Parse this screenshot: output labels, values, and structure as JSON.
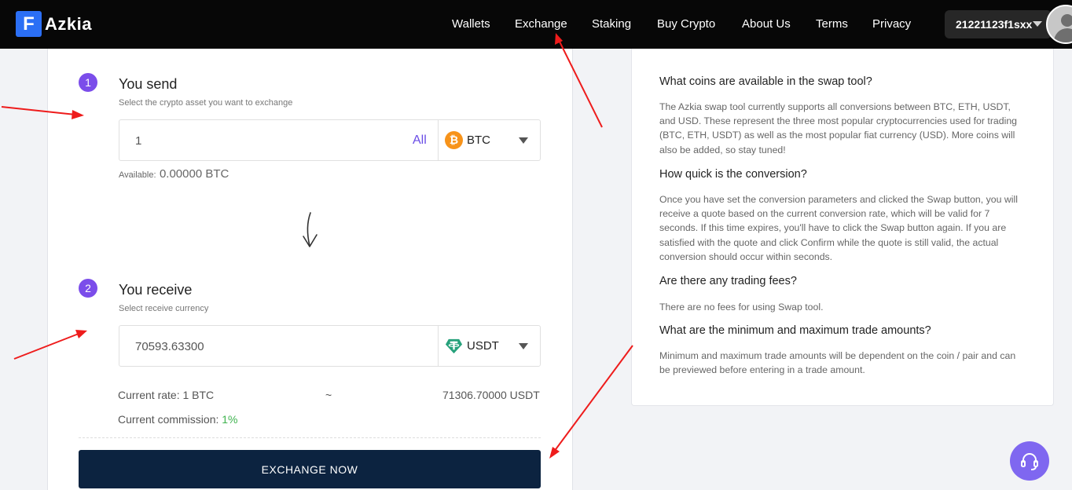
{
  "brand": {
    "mark": "F",
    "name": "Azkia"
  },
  "nav": [
    {
      "label": "Wallets"
    },
    {
      "label": "Exchange"
    },
    {
      "label": "Staking"
    },
    {
      "label": "Buy Crypto"
    },
    {
      "label": "About Us"
    },
    {
      "label": "Terms"
    },
    {
      "label": "Privacy"
    }
  ],
  "account": {
    "name": "21221123f1sxx"
  },
  "send": {
    "step": "1",
    "title": "You send",
    "subtitle": "Select the crypto asset you want to exchange",
    "amount": "1",
    "all_label": "All",
    "coin": "BTC",
    "coin_icon": "bitcoin-icon",
    "coin_color": "#f7931a",
    "available_label": "Available:",
    "available_value": "0.00000 BTC"
  },
  "receive": {
    "step": "2",
    "title": "You receive",
    "subtitle": "Select receive currency",
    "amount": "70593.63300",
    "coin": "USDT",
    "coin_icon": "tether-icon",
    "coin_color": "#26a17b"
  },
  "rate": {
    "label": "Current rate: 1 BTC",
    "approx": "~",
    "value": "71306.70000 USDT",
    "commission_label": "Current commission:",
    "commission_value": "1%"
  },
  "exchange_button": "EXCHANGE NOW",
  "faq": [
    {
      "q": "What coins are available in the swap tool?",
      "a": "The Azkia swap tool currently supports all conversions between BTC, ETH, USDT, and USD. These represent the three most popular cryptocurrencies used for trading (BTC, ETH, USDT) as well as the most popular fiat currency (USD). More coins will also be added, so stay tuned!"
    },
    {
      "q": "How quick is the conversion?",
      "a": "Once you have set the conversion parameters and clicked the Swap button, you will receive a quote based on the current conversion rate, which will be valid for 7 seconds. If this time expires, you'll have to click the Swap button again. If you are satisfied with the quote and click Confirm while the quote is still valid, the actual conversion should occur within seconds."
    },
    {
      "q": "Are there any trading fees?",
      "a": "There are no fees for using Swap tool."
    },
    {
      "q": "What are the minimum and maximum trade amounts?",
      "a": "Minimum and maximum trade amounts will be dependent on the coin / pair and can be previewed before entering in a trade amount."
    }
  ],
  "colors": {
    "header_bg": "#070707",
    "accent_purple": "#7b4dea",
    "button_navy": "#0c2340",
    "annotation_red": "#ee1c1c",
    "commission_green": "#3fb34f"
  },
  "icons": [
    "swap-down-arrow-icon",
    "headset-icon",
    "user-avatar-icon"
  ]
}
